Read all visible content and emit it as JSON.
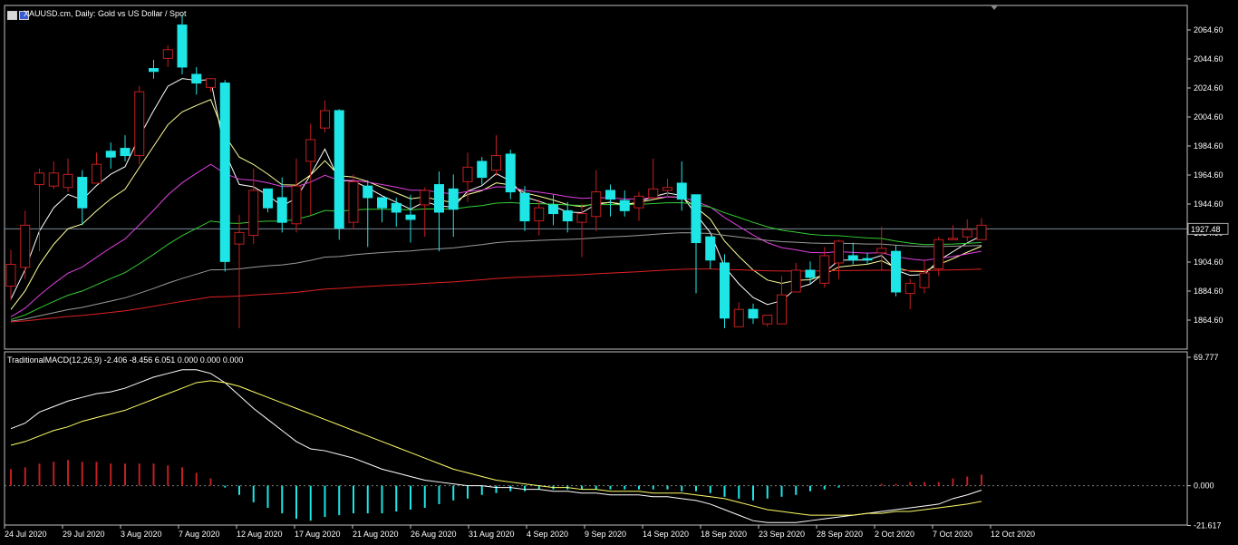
{
  "window": {
    "title": "XAUUSD.cm, Daily:  Gold vs US Dollar / Spot",
    "icon": "chart-window-icon"
  },
  "colors": {
    "background": "#000000",
    "frame": "#c0c0c0",
    "bull_candle": "#c21f1f",
    "bear_candle": "#1ee6e6",
    "ma_fast": "#ffffff",
    "ma_slow": "#ffff99",
    "ma_magenta": "#e040e0",
    "ma_green": "#33cc33",
    "ma_gray": "#9a9a9a",
    "ma_red": "#e02020",
    "macd_line": "#ffffff",
    "signal_line": "#ffff66",
    "hist_pos": "#c21f1f",
    "hist_neg": "#1ee6e6"
  },
  "chart_data": [
    {
      "type": "candlestick",
      "title": "XAUUSD.cm, Daily:  Gold vs US Dollar / Spot",
      "ylim": [
        1855,
        2080
      ],
      "y_ticks": [
        "2064.60",
        "2044.60",
        "2024.60",
        "2004.60",
        "1984.60",
        "1964.60",
        "1944.60",
        "1924.60",
        "1904.60",
        "1884.60",
        "1864.60"
      ],
      "current_price": "1927.48",
      "x_labels": [
        "24 Jul 2020",
        "29 Jul 2020",
        "3 Aug 2020",
        "7 Aug 2020",
        "12 Aug 2020",
        "17 Aug 2020",
        "21 Aug 2020",
        "26 Aug 2020",
        "31 Aug 2020",
        "4 Sep 2020",
        "9 Sep 2020",
        "14 Sep 2020",
        "18 Sep 2020",
        "23 Sep 2020",
        "28 Sep 2020",
        "2 Oct 2020",
        "7 Oct 2020",
        "12 Oct 2020"
      ],
      "candles": [
        [
          1888,
          1903,
          1878,
          1913
        ],
        [
          1901,
          1930,
          1893,
          1940
        ],
        [
          1958,
          1966,
          1912,
          1969
        ],
        [
          1957,
          1966,
          1955,
          1974
        ],
        [
          1956,
          1965,
          1953,
          1976
        ],
        [
          1963,
          1942,
          1930,
          1968
        ],
        [
          1959,
          1972,
          1960,
          1980
        ],
        [
          1981,
          1977,
          1969,
          1987
        ],
        [
          1983,
          1978,
          1974,
          1992
        ],
        [
          1978,
          2022,
          1972,
          2026
        ],
        [
          2038,
          2036,
          2031,
          2044
        ],
        [
          2045,
          2051,
          2039,
          2054
        ],
        [
          2068,
          2039,
          2034,
          2075
        ],
        [
          2034,
          2028,
          2020,
          2039
        ],
        [
          2025,
          2031,
          2022,
          2031
        ],
        [
          2028,
          1905,
          1898,
          2030
        ],
        [
          1917,
          1925,
          1859,
          1937
        ],
        [
          1923,
          1954,
          1917,
          1969
        ],
        [
          1955,
          1942,
          1939,
          1951
        ],
        [
          1949,
          1932,
          1925,
          1963
        ],
        [
          1931,
          1957,
          1925,
          1976
        ],
        [
          1974,
          1989,
          1937,
          2000
        ],
        [
          1997,
          2009,
          1994,
          2016
        ],
        [
          2009,
          1928,
          1920,
          2010
        ],
        [
          1932,
          1960,
          1927,
          1965
        ],
        [
          1957,
          1949,
          1915,
          1961
        ],
        [
          1949,
          1942,
          1932,
          1944
        ],
        [
          1945,
          1939,
          1929,
          1949
        ],
        [
          1937,
          1934,
          1918,
          1951
        ],
        [
          1944,
          1954,
          1922,
          1956
        ],
        [
          1958,
          1939,
          1912,
          1967
        ],
        [
          1955,
          1941,
          1922,
          1965
        ],
        [
          1960,
          1970,
          1946,
          1980
        ],
        [
          1974,
          1963,
          1958,
          1977
        ],
        [
          1968,
          1978,
          1964,
          1992
        ],
        [
          1979,
          1953,
          1948,
          1982
        ],
        [
          1952,
          1933,
          1926,
          1957
        ],
        [
          1933,
          1942,
          1923,
          1948
        ],
        [
          1944,
          1938,
          1930,
          1951
        ],
        [
          1940,
          1933,
          1925,
          1946
        ],
        [
          1932,
          1938,
          1908,
          1945
        ],
        [
          1936,
          1953,
          1926,
          1968
        ],
        [
          1954,
          1948,
          1936,
          1958
        ],
        [
          1947,
          1940,
          1936,
          1954
        ],
        [
          1942,
          1950,
          1933,
          1953
        ],
        [
          1949,
          1955,
          1948,
          1976
        ],
        [
          1954,
          1956,
          1949,
          1962
        ],
        [
          1959,
          1948,
          1940,
          1974
        ],
        [
          1951,
          1918,
          1883,
          1951
        ],
        [
          1922,
          1906,
          1900,
          1922
        ],
        [
          1904,
          1866,
          1859,
          1910
        ],
        [
          1860,
          1872,
          1862,
          1877
        ],
        [
          1872,
          1866,
          1862,
          1876
        ],
        [
          1862,
          1868,
          1860,
          1868
        ],
        [
          1862,
          1882,
          1867,
          1895
        ],
        [
          1884,
          1899,
          1886,
          1904
        ],
        [
          1899,
          1894,
          1890,
          1905
        ],
        [
          1890,
          1909,
          1887,
          1915
        ],
        [
          1904,
          1919,
          1893,
          1920
        ],
        [
          1909,
          1906,
          1903,
          1918
        ],
        [
          1907,
          1906,
          1903,
          1911
        ],
        [
          1911,
          1914,
          1899,
          1929
        ],
        [
          1912,
          1884,
          1881,
          1916
        ],
        [
          1883,
          1890,
          1872,
          1893
        ],
        [
          1887,
          1897,
          1883,
          1906
        ],
        [
          1900,
          1920,
          1895,
          1922
        ],
        [
          1920,
          1921,
          1920,
          1930
        ],
        [
          1922,
          1927,
          1919,
          1934
        ],
        [
          1920,
          1930,
          1923,
          1935
        ]
      ]
    },
    {
      "type": "macd",
      "title": "TraditionalMACD(12,26,9) -2.406 -8.456 6.051 0.000 0.000 0.000",
      "ylim": [
        -21.617,
        69.777
      ],
      "y_ticks": [
        "69.777",
        "0.000",
        "-21.617"
      ],
      "macd": [
        31,
        34,
        40,
        43,
        46,
        48,
        50,
        51,
        53,
        56,
        59,
        61,
        63,
        63,
        61,
        56,
        49,
        42,
        36,
        30,
        24,
        20,
        19,
        17,
        15,
        12,
        9,
        7,
        5,
        3,
        2,
        1,
        0,
        0,
        -1,
        -1,
        -2,
        -2,
        -3,
        -3,
        -4,
        -4,
        -5,
        -5,
        -5,
        -6,
        -6,
        -7,
        -8,
        -10,
        -13,
        -16,
        -19,
        -20,
        -20,
        -20,
        -19,
        -18,
        -17,
        -16,
        -15,
        -14,
        -13,
        -12,
        -11,
        -10,
        -7,
        -5,
        -2.4
      ],
      "signal": [
        22,
        24,
        27,
        30,
        32,
        35,
        37,
        39,
        41,
        44,
        47,
        50,
        53,
        56,
        57,
        56,
        54,
        51,
        48,
        45,
        42,
        39,
        36,
        33,
        30,
        27,
        24,
        21,
        18,
        15,
        12,
        9,
        7,
        5,
        3,
        2,
        1,
        0,
        -1,
        -1,
        -2,
        -2,
        -3,
        -3,
        -3,
        -4,
        -4,
        -4,
        -5,
        -6,
        -7,
        -9,
        -11,
        -13,
        -14,
        -15,
        -16,
        -16,
        -16,
        -16,
        -15,
        -15,
        -14,
        -14,
        -13,
        -12,
        -11,
        -10,
        -8.5
      ],
      "histogram": [
        9,
        10,
        12,
        13,
        14,
        13,
        13,
        12,
        12,
        12,
        12,
        11,
        10,
        7,
        4,
        -1,
        -5,
        -9,
        -12,
        -15,
        -18,
        -19,
        -17,
        -16,
        -15,
        -15,
        -15,
        -14,
        -13,
        -12,
        -10,
        -8,
        -7,
        -5,
        -4,
        -3,
        -3,
        -2,
        -2,
        -2,
        -2,
        -2,
        -2,
        -2,
        -2,
        -2,
        -2,
        -3,
        -3,
        -4,
        -6,
        -7,
        -8,
        -7,
        -6,
        -5,
        -3,
        -2,
        -1,
        0,
        0,
        1,
        1,
        2,
        2,
        2,
        4,
        5,
        6.05
      ]
    }
  ]
}
